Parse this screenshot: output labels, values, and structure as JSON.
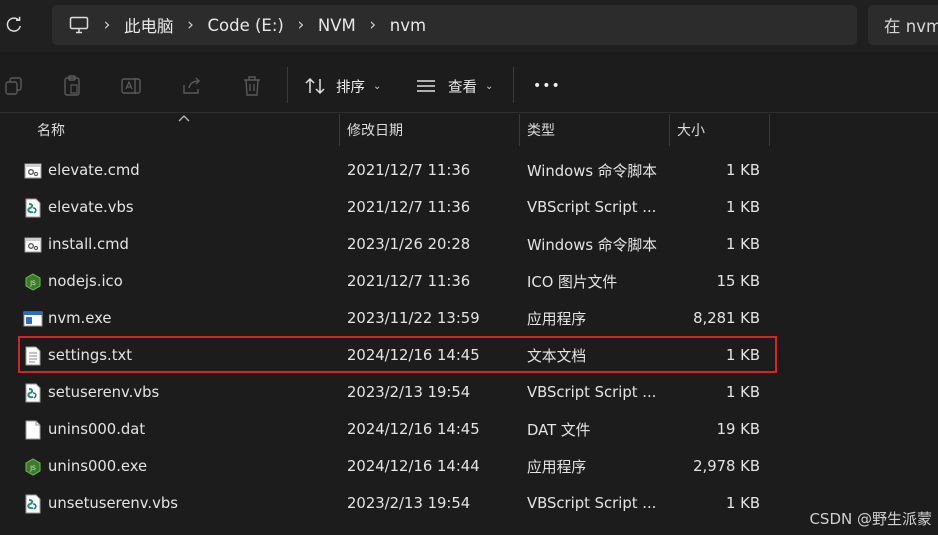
{
  "address_bar": {
    "crumbs": [
      "此电脑",
      "Code (E:)",
      "NVM",
      "nvm"
    ],
    "separator": "›",
    "search_partial": "在 nvm"
  },
  "toolbar": {
    "sort_label": "排序",
    "view_label": "查看",
    "more_label": "•••",
    "caret": "⌄",
    "icons": [
      "copy-icon",
      "paste-icon",
      "rename-icon",
      "share-icon",
      "delete-icon",
      "sort-icon",
      "view-icon"
    ]
  },
  "columns": {
    "name": "名称",
    "date": "修改日期",
    "type": "类型",
    "size": "大小"
  },
  "files": [
    {
      "name": "elevate.cmd",
      "date": "2021/12/7 11:36",
      "type": "Windows 命令脚本",
      "size": "1 KB",
      "icon": "cmd-file-icon"
    },
    {
      "name": "elevate.vbs",
      "date": "2021/12/7 11:36",
      "type": "VBScript Script ...",
      "size": "1 KB",
      "icon": "vbs-file-icon"
    },
    {
      "name": "install.cmd",
      "date": "2023/1/26 20:28",
      "type": "Windows 命令脚本",
      "size": "1 KB",
      "icon": "cmd-file-icon"
    },
    {
      "name": "nodejs.ico",
      "date": "2021/12/7 11:36",
      "type": "ICO 图片文件",
      "size": "15 KB",
      "icon": "nodejs-icon"
    },
    {
      "name": "nvm.exe",
      "date": "2023/11/22 13:59",
      "type": "应用程序",
      "size": "8,281 KB",
      "icon": "exe-file-icon"
    },
    {
      "name": "settings.txt",
      "date": "2024/12/16 14:45",
      "type": "文本文档",
      "size": "1 KB",
      "icon": "text-file-icon"
    },
    {
      "name": "setuserenv.vbs",
      "date": "2023/2/13 19:54",
      "type": "VBScript Script ...",
      "size": "1 KB",
      "icon": "vbs-file-icon"
    },
    {
      "name": "unins000.dat",
      "date": "2024/12/16 14:45",
      "type": "DAT 文件",
      "size": "19 KB",
      "icon": "blank-file-icon"
    },
    {
      "name": "unins000.exe",
      "date": "2024/12/16 14:44",
      "type": "应用程序",
      "size": "2,978 KB",
      "icon": "nodejs-icon"
    },
    {
      "name": "unsetuserenv.vbs",
      "date": "2023/2/13 19:54",
      "type": "VBScript Script ...",
      "size": "1 KB",
      "icon": "vbs-file-icon"
    }
  ],
  "highlight_color": "#d4242a",
  "watermark": "CSDN @野生派蒙"
}
